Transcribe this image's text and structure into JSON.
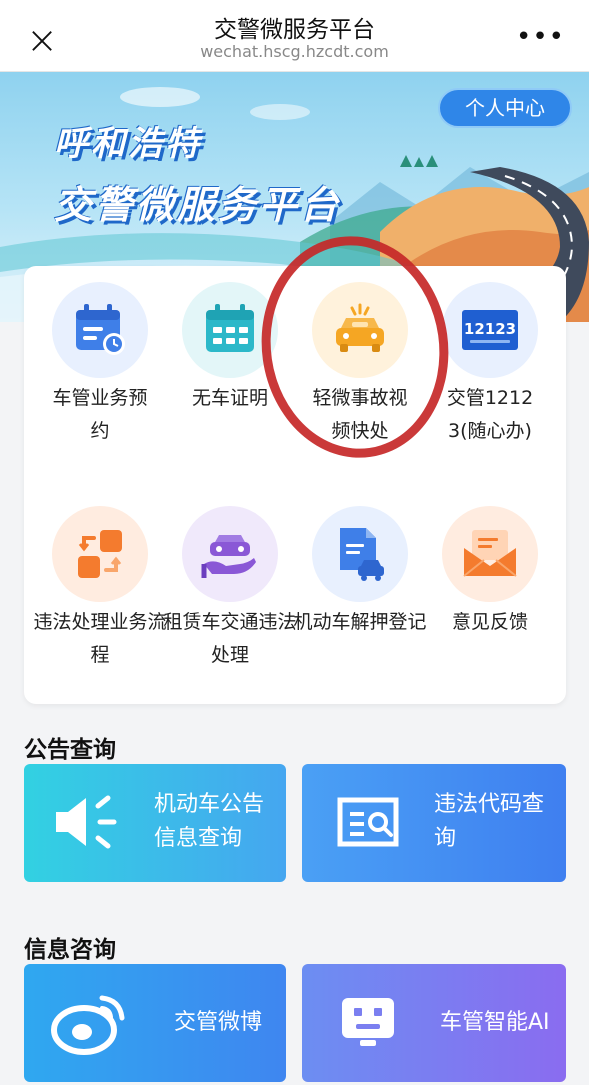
{
  "nav": {
    "close_glyph": "×",
    "title": "交警微服务平台",
    "url": "wechat.hscg.hzcdt.com",
    "more_glyph": "•••"
  },
  "banner": {
    "title_line1": "呼和浩特",
    "title_line2": "交警微服务平台",
    "personal_center": "个人中心"
  },
  "services": [
    {
      "label": "车管业务预约",
      "icon": "calendar-clock-icon",
      "bg": "#e8f0fe",
      "color": "#3f7fe8"
    },
    {
      "label": "无车证明",
      "icon": "calendar-icon",
      "bg": "#e3f6f8",
      "color": "#2cb8c9"
    },
    {
      "label": "轻微事故视频快处",
      "icon": "car-crash-icon",
      "bg": "#fff2dc",
      "color": "#f5a623"
    },
    {
      "label": "交管12123(随心办)",
      "icon": "app-12123-icon",
      "bg": "#e8f0fe",
      "color": "#1f5fd1"
    },
    {
      "label": "违法处理业务流程",
      "icon": "process-flow-icon",
      "bg": "#ffece0",
      "color": "#f47b2e"
    },
    {
      "label": "租赁车交通违法处理",
      "icon": "hand-car-icon",
      "bg": "#f0e9fb",
      "color": "#8a58d6"
    },
    {
      "label": "机动车解押登记",
      "icon": "document-car-icon",
      "bg": "#e8f0fe",
      "color": "#3f7fe8"
    },
    {
      "label": "意见反馈",
      "icon": "envelope-icon",
      "bg": "#ffece0",
      "color": "#f47b2e"
    }
  ],
  "app_12123_text": "12123",
  "announcement": {
    "title": "公告查询",
    "tiles": [
      {
        "label": "机动车公告信息查询",
        "icon": "speaker-icon"
      },
      {
        "label": "违法代码查询",
        "icon": "code-search-icon"
      }
    ]
  },
  "info": {
    "title": "信息咨询",
    "tiles": [
      {
        "label": "交管微博",
        "icon": "weibo-icon"
      },
      {
        "label": "车管智能AI",
        "icon": "robot-icon"
      }
    ]
  },
  "colors": {
    "accent_blue": "#2f86e8",
    "tile_cyan_start": "#2fd0e3",
    "tile_blue_end": "#3f7ff0",
    "tile_purple_end": "#8a6cf0",
    "highlight_red": "#c62828"
  }
}
